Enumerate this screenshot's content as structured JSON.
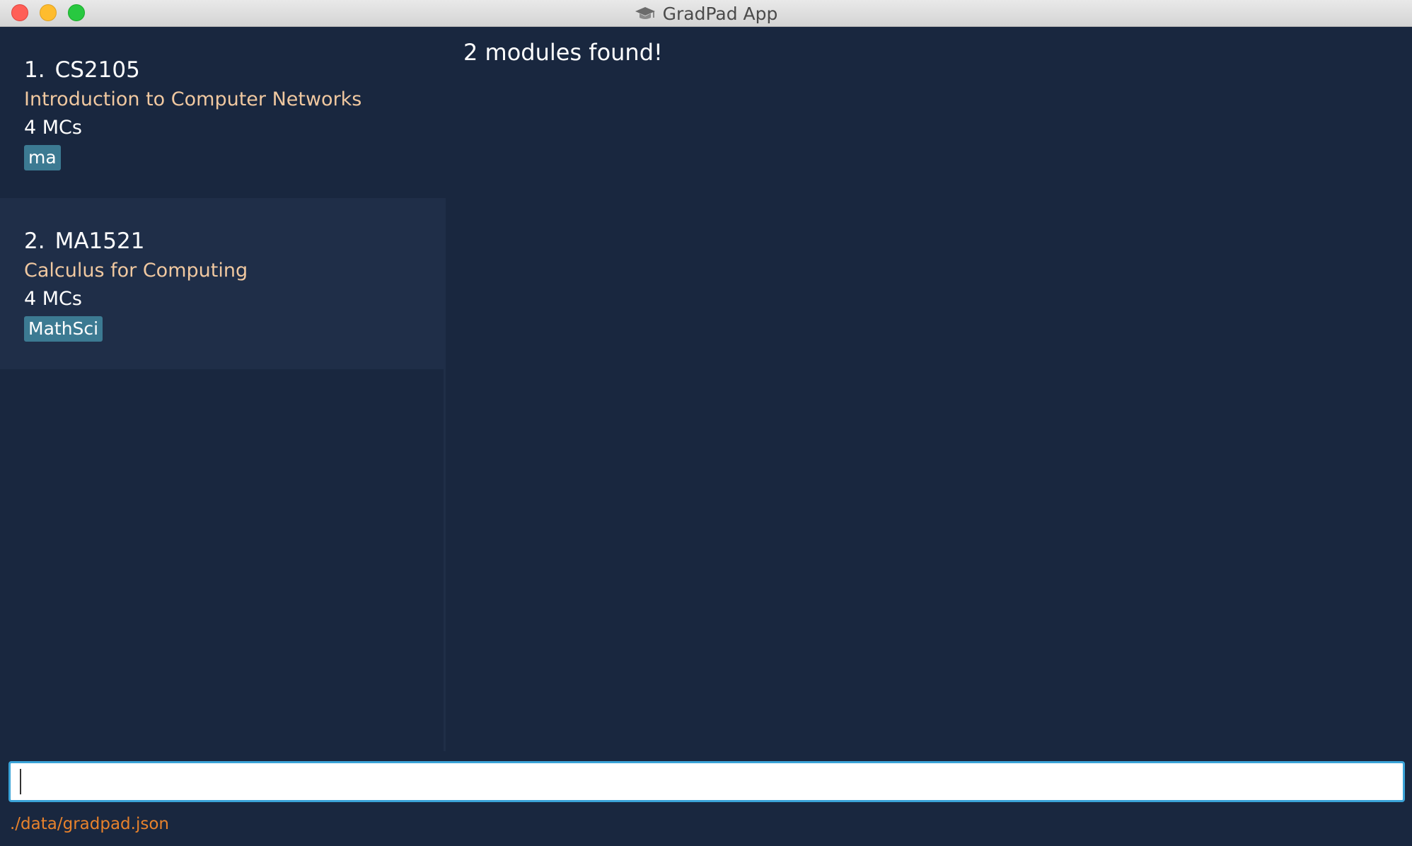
{
  "window": {
    "title": "GradPad App",
    "icon": "graduation-cap-icon"
  },
  "modules": [
    {
      "index": "1.",
      "code": "CS2105",
      "title": "Introduction to Computer Networks",
      "credits": "4 MCs",
      "tags": [
        "ma"
      ]
    },
    {
      "index": "2.",
      "code": "MA1521",
      "title": "Calculus for Computing",
      "credits": "4 MCs",
      "tags": [
        "MathSci"
      ]
    }
  ],
  "result": {
    "message": "2 modules found!"
  },
  "command": {
    "value": ""
  },
  "status": {
    "file_path": "./data/gradpad.json"
  },
  "colors": {
    "background": "#19273f",
    "card_alt": "#1f2e48",
    "module_title": "#f0c8a0",
    "tag_background": "#3c7a92",
    "command_border": "#3aa3d8",
    "status_text": "#e8822c"
  }
}
